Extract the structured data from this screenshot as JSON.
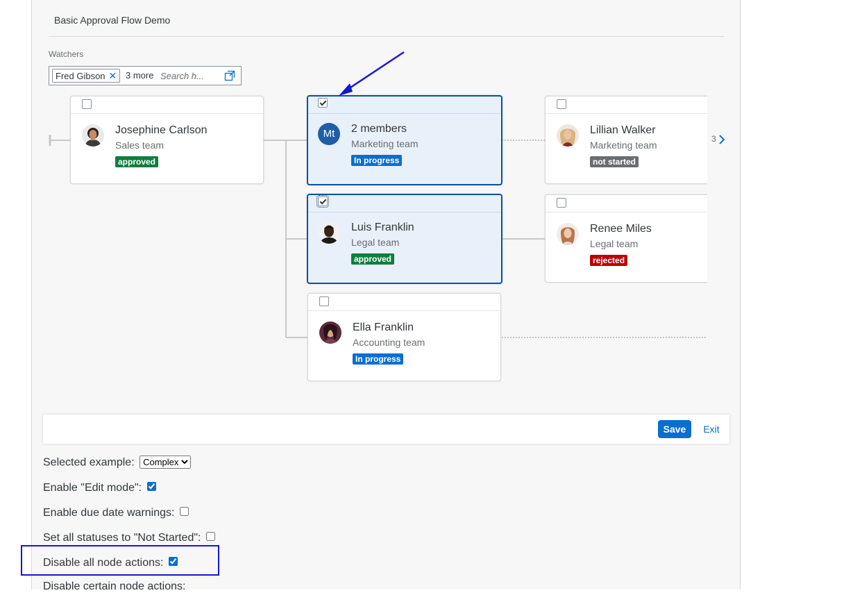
{
  "demo": {
    "title": "Basic Approval Flow Demo"
  },
  "watchers": {
    "label": "Watchers",
    "token": "Fred Gibson",
    "more": "3 more",
    "placeholder": "Search h..."
  },
  "nodes": [
    {
      "name": "Josephine Carlson",
      "team": "Sales team",
      "status": "approved",
      "selected": false,
      "checked": false
    },
    {
      "name": "2 members",
      "initials": "Mt",
      "team": "Marketing team",
      "status": "In progress",
      "selected": true,
      "checked": true
    },
    {
      "name": "Luis Franklin",
      "team": "Legal team",
      "status": "approved",
      "selected": true,
      "checked": true
    },
    {
      "name": "Ella Franklin",
      "team": "Accounting team",
      "status": "In progress",
      "selected": false,
      "checked": false
    },
    {
      "name": "Lillian Walker",
      "team": "Marketing team",
      "status": "not started",
      "selected": false,
      "checked": false
    },
    {
      "name": "Renee Miles",
      "team": "Legal team",
      "status": "rejected",
      "selected": false,
      "checked": false
    }
  ],
  "pager": {
    "count": "3"
  },
  "footer": {
    "save": "Save",
    "exit": "Exit"
  },
  "options": {
    "selected_example": {
      "label": "Selected example:",
      "value": "Complex"
    },
    "edit_mode": {
      "label": "Enable \"Edit mode\":",
      "checked": true
    },
    "due_date": {
      "label": "Enable due date warnings:",
      "checked": false
    },
    "not_started": {
      "label": "Set all statuses to \"Not Started\":",
      "checked": false
    },
    "disable_all": {
      "label": "Disable all node actions:",
      "checked": true
    },
    "disable_certain": {
      "label": "Disable certain node actions:"
    }
  },
  "colors": {
    "accent": "#0a6ed1",
    "selected_border": "#0854a0",
    "approved": "#107e3e",
    "in_progress": "#0a6ed1",
    "not_started": "#6a6d70",
    "rejected": "#bb0000",
    "annotation": "#1515d8"
  },
  "icons": [
    "decline-icon",
    "value-help-icon",
    "chevron-right-icon",
    "annotation-arrow"
  ]
}
